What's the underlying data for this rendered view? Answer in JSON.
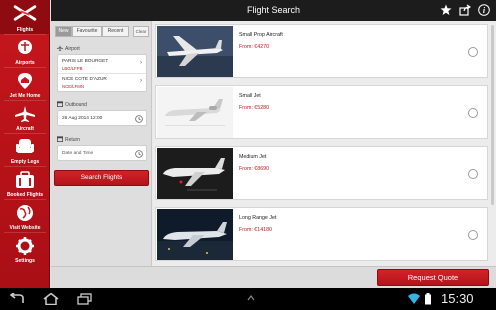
{
  "sidebar": {
    "items": [
      {
        "label": "Flights",
        "icon": "plane-logo-icon",
        "active": true
      },
      {
        "label": "Airports",
        "icon": "map-pin-icon"
      },
      {
        "label": "Jet Me Home",
        "icon": "home-pin-icon"
      },
      {
        "label": "Aircraft",
        "icon": "airplane-icon"
      },
      {
        "label": "Empty Legs",
        "icon": "seat-icon"
      },
      {
        "label": "Booked Flights",
        "icon": "briefcase-icon"
      },
      {
        "label": "Visit Website",
        "icon": "globe-icon"
      },
      {
        "label": "Settings",
        "icon": "gear-icon"
      }
    ]
  },
  "topbar": {
    "title": "Flight Search",
    "icons": [
      "star-icon",
      "share-icon",
      "info-icon"
    ]
  },
  "search_panel": {
    "tabs": [
      "New",
      "Favourite",
      "Recent"
    ],
    "selected_tab": "New",
    "clear_label": "Clear",
    "airport_label": "Airport",
    "from": {
      "name": "PARIS LE BOURGET",
      "code": "LBG/LFPB"
    },
    "to": {
      "name": "NICE COTE D'AZUR",
      "code": "NCE/LFMN"
    },
    "outbound_label": "Outbound",
    "outbound_value": "26 Aug 2014  12:00",
    "return_label": "Return",
    "return_placeholder": "Date and Time",
    "search_button": "Search Flights"
  },
  "results": [
    {
      "name": "Small Prop Aircraft",
      "price": "From: €4270",
      "thumb": "prop"
    },
    {
      "name": "Small Jet",
      "price": "From: €5280",
      "thumb": "small-jet"
    },
    {
      "name": "Medium Jet",
      "price": "From: €8690",
      "thumb": "medium-jet"
    },
    {
      "name": "Long Range Jet",
      "price": "From: €14180",
      "thumb": "long-jet"
    }
  ],
  "action": {
    "request_quote": "Request Quote"
  },
  "system": {
    "time": "15:30",
    "colors": {
      "brand_red": "#c7161d",
      "price_red": "#c21a21"
    }
  }
}
